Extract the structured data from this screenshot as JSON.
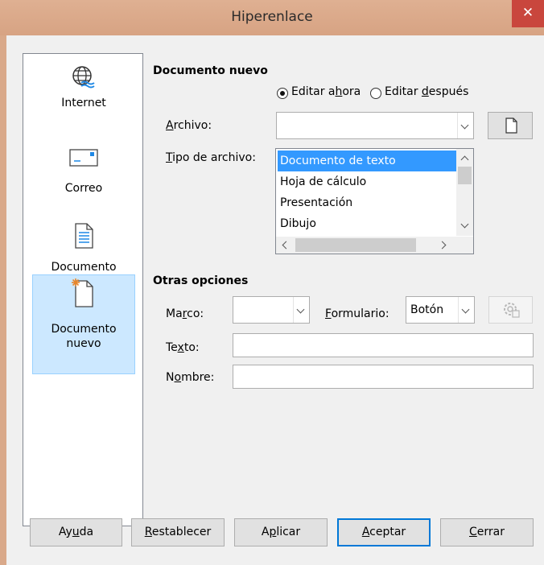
{
  "window": {
    "title": "Hiperenlace",
    "close_glyph": "✕"
  },
  "sidebar": {
    "items": [
      {
        "label": "Internet",
        "icon": "globe-icon"
      },
      {
        "label": "Correo",
        "icon": "envelope-icon"
      },
      {
        "label": "Documento",
        "icon": "document-icon"
      },
      {
        "label_line1": "Documento",
        "label_line2": "nuevo",
        "icon": "new-document-icon",
        "selected": true
      }
    ]
  },
  "new_document": {
    "heading": "Documento nuevo",
    "radio_edit_now_pre": "Editar a",
    "radio_edit_now_key": "h",
    "radio_edit_now_post": "ora",
    "radio_edit_later_pre": "Editar ",
    "radio_edit_later_key": "d",
    "radio_edit_later_post": "espués",
    "file_label_key": "A",
    "file_label_rest": "rchivo:",
    "file_value": "",
    "filetype_label_key": "T",
    "filetype_label_rest": "ipo de archivo:",
    "filetypes": [
      "Documento de texto",
      "Hoja de cálculo",
      "Presentación",
      "Dibujo"
    ],
    "selected_filetype": "Documento de texto"
  },
  "other_options": {
    "heading": "Otras opciones",
    "frame_label_pre": "Ma",
    "frame_label_key": "r",
    "frame_label_post": "co:",
    "frame_value": "",
    "form_label_key": "F",
    "form_label_rest": "ormulario:",
    "form_value": "Botón",
    "text_label_pre": "Te",
    "text_label_key": "x",
    "text_label_post": "to:",
    "text_value": "",
    "name_label_pre": "N",
    "name_label_key": "o",
    "name_label_post": "mbre:",
    "name_value": ""
  },
  "buttons": {
    "help_pre": "Ay",
    "help_key": "u",
    "help_post": "da",
    "reset_key": "R",
    "reset_rest": "establecer",
    "apply_pre": "A",
    "apply_key": "p",
    "apply_post": "licar",
    "accept_key": "A",
    "accept_rest": "ceptar",
    "close_key": "C",
    "close_rest": "errar"
  },
  "colors": {
    "titlebar": "#dda98b",
    "close": "#c9463d",
    "selection": "#3399ff",
    "sidebar_selected": "#cce8ff",
    "default_button_border": "#0078d7"
  }
}
